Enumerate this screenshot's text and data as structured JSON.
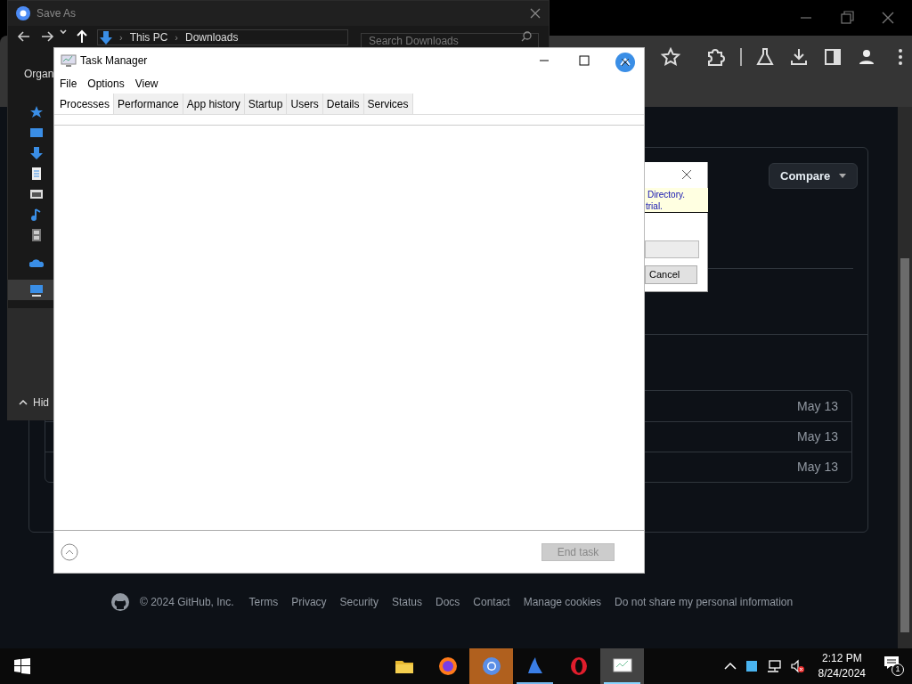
{
  "browser": {
    "page": {
      "compare_button": "Compare",
      "list_rows": [
        {
          "date": "May 13"
        },
        {
          "date": "May 13"
        },
        {
          "date": "May 13"
        }
      ],
      "footer": {
        "copyright": "© 2024 GitHub, Inc.",
        "links": [
          "Terms",
          "Privacy",
          "Security",
          "Status",
          "Docs",
          "Contact",
          "Manage cookies",
          "Do not share my personal information"
        ]
      }
    }
  },
  "save_as_dialog": {
    "title": "Save As",
    "breadcrumb": [
      {
        "separator": "›",
        "label": "This PC"
      },
      {
        "separator": "›",
        "label": "Downloads"
      }
    ],
    "search": {
      "placeholder": "Search Downloads"
    },
    "organize": "Organ",
    "sidebar": {
      "items": [
        {
          "selected": false
        },
        {
          "selected": false
        },
        {
          "selected": false
        },
        {
          "selected": false
        },
        {
          "selected": false
        },
        {
          "selected": false
        },
        {
          "selected": false
        },
        {
          "selected": false
        },
        {
          "selected": true
        }
      ]
    },
    "hide_folders": "Hid"
  },
  "message_dialog": {
    "info_lines": [
      "Directory.",
      "trial."
    ],
    "cancel_button": "Cancel"
  },
  "task_manager": {
    "title": "Task Manager",
    "menu": [
      "File",
      "Options",
      "View"
    ],
    "tabs": [
      {
        "label": "Processes",
        "selected": true
      },
      {
        "label": "Performance",
        "selected": false
      },
      {
        "label": "App history",
        "selected": false
      },
      {
        "label": "Startup",
        "selected": false
      },
      {
        "label": "Users",
        "selected": false
      },
      {
        "label": "Details",
        "selected": false
      },
      {
        "label": "Services",
        "selected": false
      }
    ],
    "end_task_button": {
      "label": "End task",
      "disabled": true
    }
  },
  "taskbar": {
    "apps": [
      {
        "kind": "folder",
        "running": false,
        "attention": false,
        "focused": false
      },
      {
        "kind": "firefox",
        "running": false,
        "attention": false,
        "focused": false
      },
      {
        "kind": "chromium",
        "running": false,
        "attention": true,
        "focused": false
      },
      {
        "kind": "sail",
        "running": true,
        "attention": false,
        "focused": false
      },
      {
        "kind": "opera",
        "running": false,
        "attention": false,
        "focused": false
      },
      {
        "kind": "monitor",
        "running": true,
        "attention": false,
        "focused": true
      }
    ],
    "volume_muted": true,
    "time": "2:12 PM",
    "date": "8/24/2024",
    "notification_count": "1"
  }
}
